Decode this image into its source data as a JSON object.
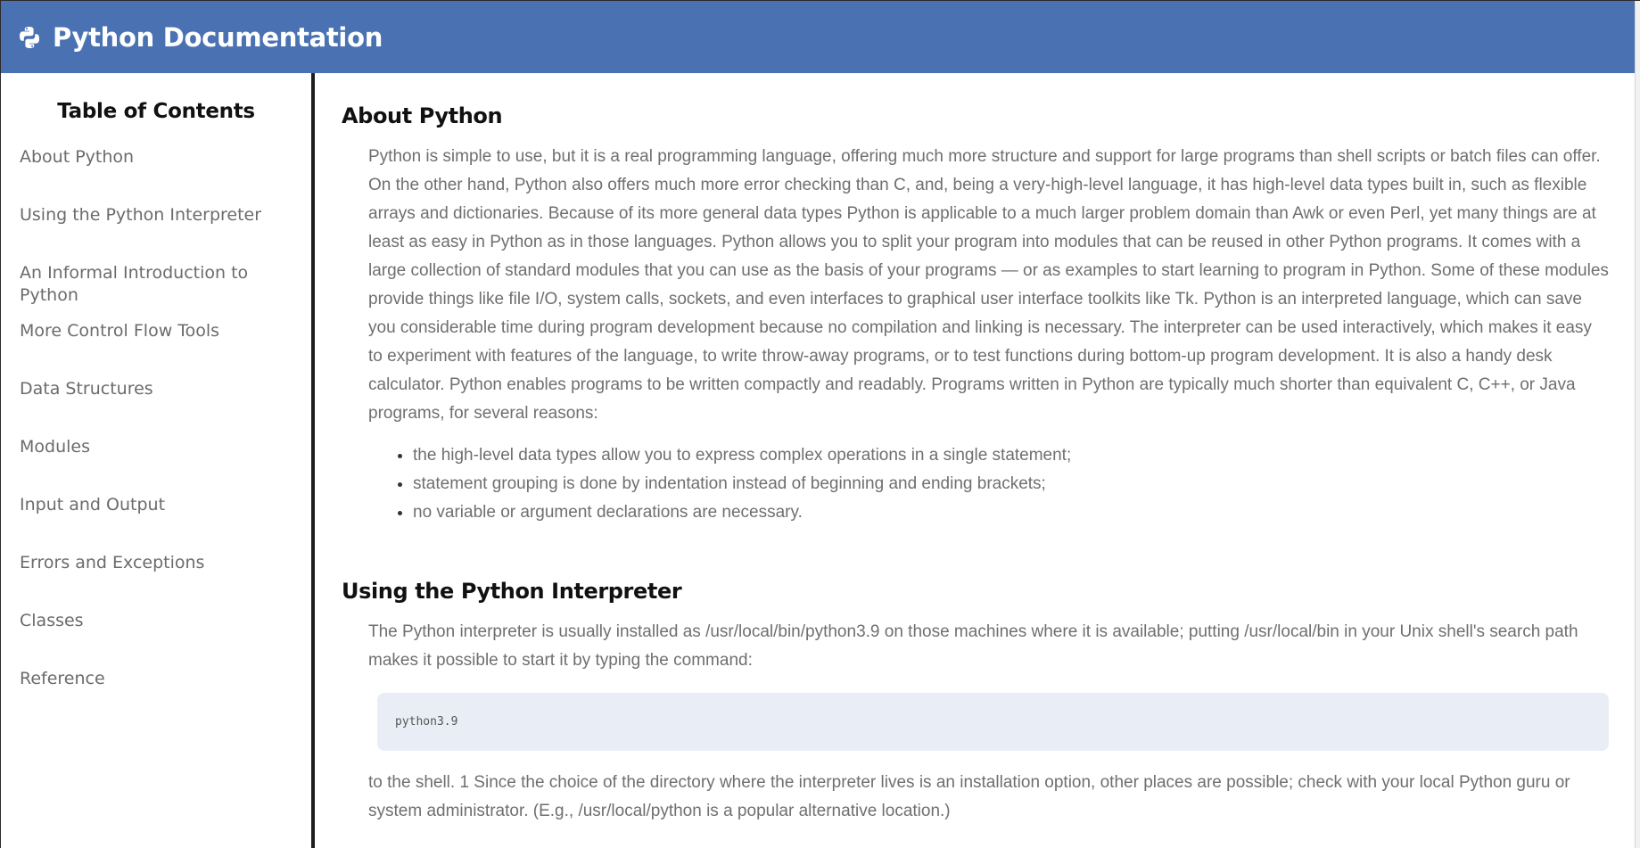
{
  "header": {
    "title": "Python Documentation",
    "logo_icon": "python-logo-icon",
    "background_color": "#4a72b2"
  },
  "sidebar": {
    "title": "Table of Contents",
    "items": [
      {
        "label": "About Python"
      },
      {
        "label": "Using the Python Interpreter"
      },
      {
        "label": "An Informal Introduction to Python"
      },
      {
        "label": "More Control Flow Tools"
      },
      {
        "label": "Data Structures"
      },
      {
        "label": "Modules"
      },
      {
        "label": "Input and Output"
      },
      {
        "label": "Errors and Exceptions"
      },
      {
        "label": "Classes"
      },
      {
        "label": "Reference"
      }
    ]
  },
  "main": {
    "sections": [
      {
        "title": "About Python",
        "paragraph": "Python is simple to use, but it is a real programming language, offering much more structure and support for large programs than shell scripts or batch files can offer. On the other hand, Python also offers much more error checking than C, and, being a very-high-level language, it has high-level data types built in, such as flexible arrays and dictionaries. Because of its more general data types Python is applicable to a much larger problem domain than Awk or even Perl, yet many things are at least as easy in Python as in those languages. Python allows you to split your program into modules that can be reused in other Python programs. It comes with a large collection of standard modules that you can use as the basis of your programs — or as examples to start learning to program in Python. Some of these modules provide things like file I/O, system calls, sockets, and even interfaces to graphical user interface toolkits like Tk. Python is an interpreted language, which can save you considerable time during program development because no compilation and linking is necessary. The interpreter can be used interactively, which makes it easy to experiment with features of the language, to write throw-away programs, or to test functions during bottom-up program development. It is also a handy desk calculator. Python enables programs to be written compactly and readably. Programs written in Python are typically much shorter than equivalent C, C++, or Java programs, for several reasons:",
        "bullets": [
          "the high-level data types allow you to express complex operations in a single statement;",
          "statement grouping is done by indentation instead of beginning and ending brackets;",
          "no variable or argument declarations are necessary."
        ]
      },
      {
        "title": "Using the Python Interpreter",
        "paragraph": "The Python interpreter is usually installed as /usr/local/bin/python3.9 on those machines where it is available; putting /usr/local/bin in your Unix shell's search path makes it possible to start it by typing the command:",
        "code": "python3.9",
        "paragraph_after": "to the shell. 1 Since the choice of the directory where the interpreter lives is an installation option, other places are possible; check with your local Python guru or system administrator. (E.g., /usr/local/python is a popular alternative location.)"
      }
    ]
  }
}
